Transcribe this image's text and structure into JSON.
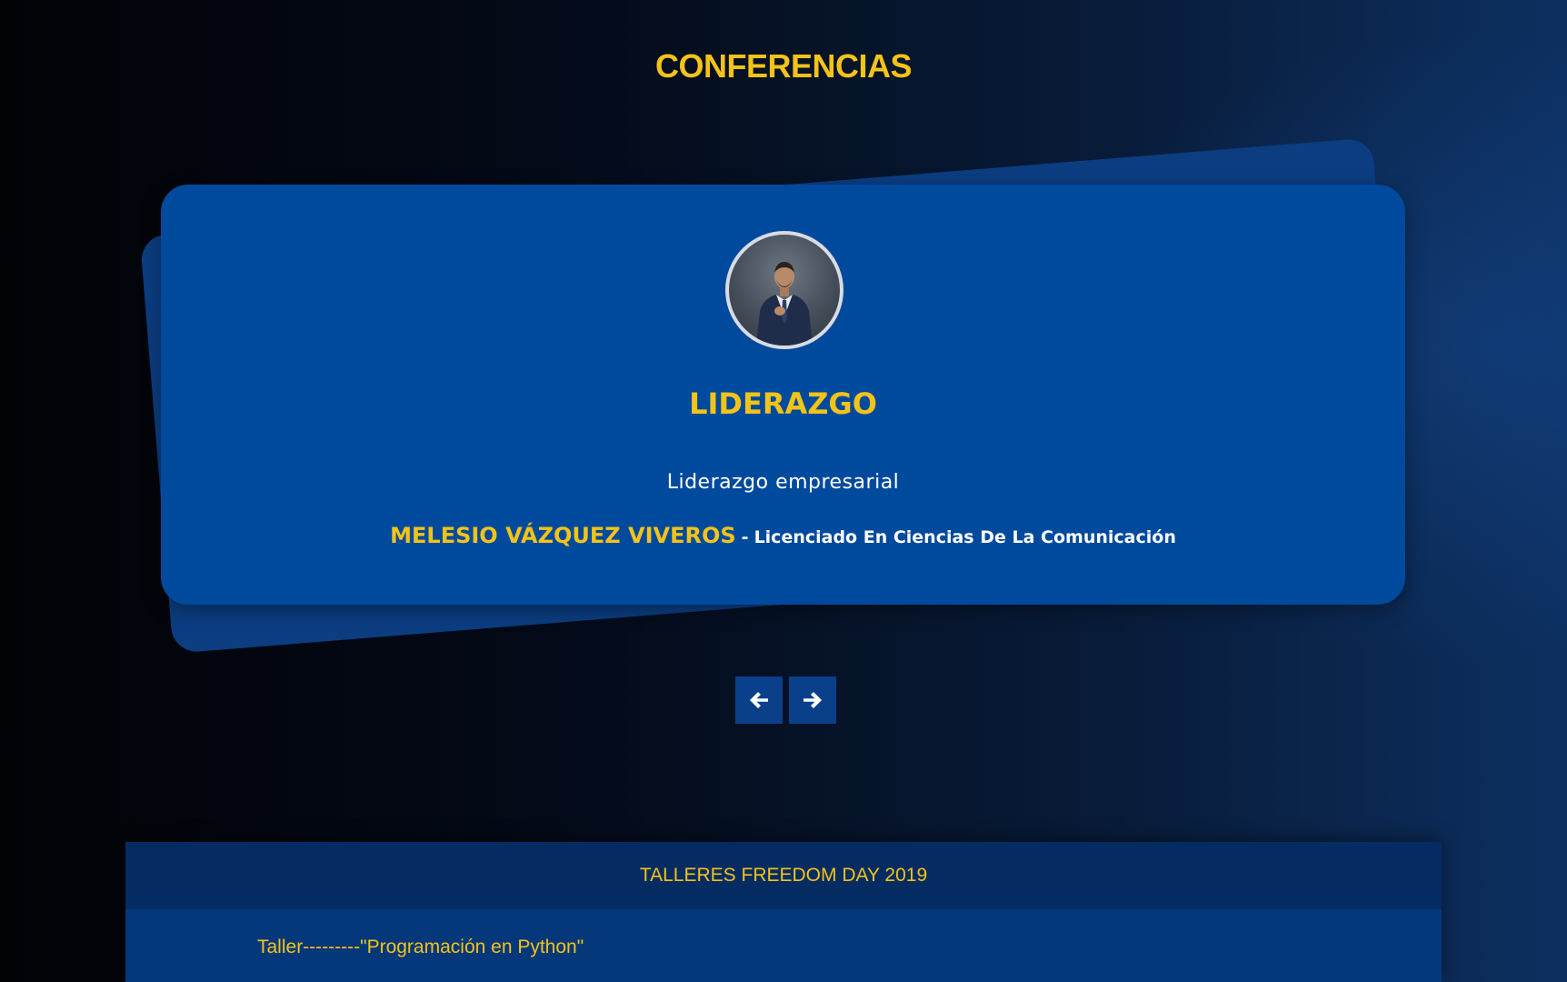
{
  "section": {
    "title": "CONFERENCIAS"
  },
  "slide": {
    "title": "LIDERAZGO",
    "description": "Liderazgo empresarial",
    "speaker_name": "MELESIO VÁZQUEZ VIVEROS",
    "separator": "-",
    "speaker_role": "Licenciado En Ciencias De La Comunicación"
  },
  "carousel": {
    "prev_icon": "arrow-left-icon",
    "next_icon": "arrow-right-icon"
  },
  "talleres": {
    "header": "TALLERES FREEDOM DAY 2019",
    "items": [
      "Taller---------\"Programación en Python\""
    ]
  },
  "colors": {
    "accent": "#f3c318",
    "card": "#004a9e",
    "card_back": "#0b3d80",
    "panel": "#05387a",
    "panel_header": "#042c63"
  }
}
